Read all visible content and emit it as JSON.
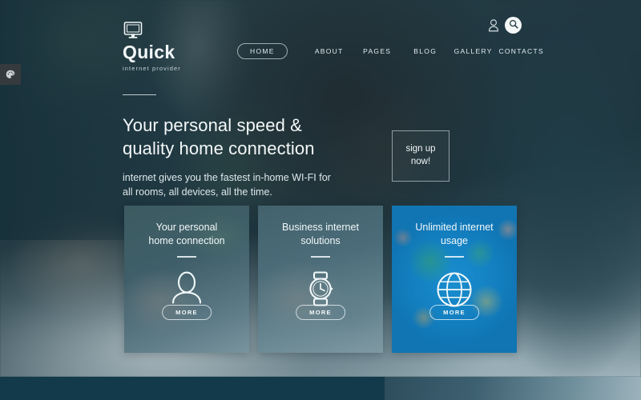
{
  "brand": {
    "logo_icon": "monitor-icon",
    "name": "Quick",
    "tagline": "internet provider"
  },
  "nav": {
    "items": [
      {
        "label": "HOME",
        "active": true
      },
      {
        "label": "ABOUT",
        "active": false
      },
      {
        "label": "PAGES",
        "active": false
      },
      {
        "label": "BLOG",
        "active": false
      },
      {
        "label": "GALLERY",
        "active": false
      },
      {
        "label": "CONTACTS",
        "active": false
      }
    ]
  },
  "header_tools": {
    "account_icon": "user-icon",
    "search_icon": "search-icon"
  },
  "side_tab": {
    "icon": "palette-icon"
  },
  "hero": {
    "title": "Your personal speed &\nquality home connection",
    "subtitle": "internet gives you the fastest in-home WI-FI for\nall rooms, all devices, all the time.",
    "cta_label": "sign up\nnow!"
  },
  "cards": [
    {
      "title": "Your personal\nhome connection",
      "icon": "user-avatar-icon",
      "more_label": "MORE"
    },
    {
      "title": "Business internet\nsolutions",
      "icon": "wristwatch-icon",
      "more_label": "MORE"
    },
    {
      "title": "Unlimited internet\nusage",
      "icon": "globe-icon",
      "more_label": "MORE"
    }
  ],
  "colors": {
    "hero_overlay": "#1a343f",
    "footer_bar": "#123a4b",
    "accent_blue": "#1a93d4",
    "text_light": "#f3f8f9"
  }
}
